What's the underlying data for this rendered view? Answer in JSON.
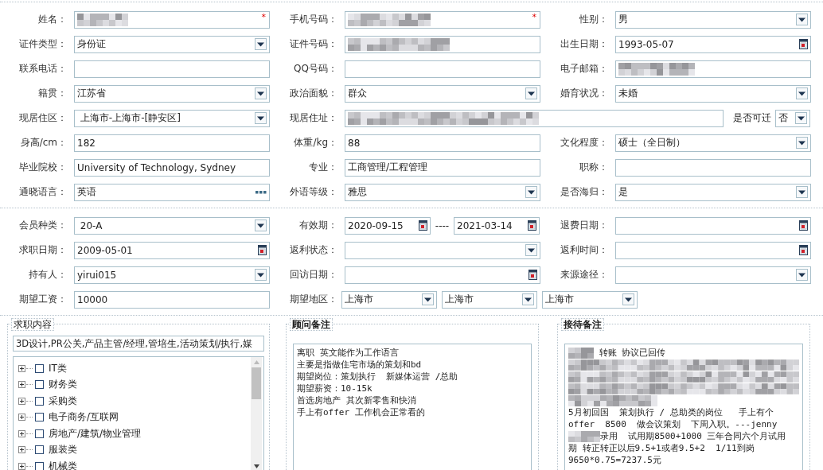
{
  "profile_rows": [
    [
      {
        "label": "姓名：",
        "kind": "blurred",
        "required_mark": "*"
      },
      {
        "label": "手机号码：",
        "kind": "blurred",
        "required_mark": "*"
      },
      {
        "label": "性别：",
        "kind": "select",
        "value": "男"
      }
    ],
    [
      {
        "label": "证件类型：",
        "kind": "select",
        "value": "身份证"
      },
      {
        "label": "证件号码：",
        "kind": "blurred"
      },
      {
        "label": "出生日期：",
        "kind": "date",
        "value": "1993-05-07"
      }
    ],
    [
      {
        "label": "联系电话：",
        "kind": "text"
      },
      {
        "label": "QQ号码：",
        "kind": "text"
      },
      {
        "label": "电子邮箱：",
        "kind": "blurred"
      }
    ],
    [
      {
        "label": "籍贯：",
        "kind": "select",
        "value": "江苏省"
      },
      {
        "label": "政治面貌：",
        "kind": "select",
        "value": "群众"
      },
      {
        "label": "婚育状况：",
        "kind": "select",
        "value": "未婚"
      }
    ],
    [
      {
        "label": "现居住区：",
        "kind": "select",
        "value": " 上海市-上海市-[静安区]"
      },
      {
        "label": "现居住址：",
        "kind": "address",
        "relocate": {
          "label": "是否可迁",
          "value": "否"
        }
      }
    ],
    [
      {
        "label": "身高/cm：",
        "kind": "text",
        "value": "182"
      },
      {
        "label": "体重/kg：",
        "kind": "text",
        "value": "88"
      },
      {
        "label": "文化程度：",
        "kind": "select",
        "value": "硕士（全日制）"
      }
    ],
    [
      {
        "label": "毕业院校：",
        "kind": "text",
        "value": "University of Technology, Sydney"
      },
      {
        "label": "专业：",
        "kind": "text",
        "value": "工商管理/工程管理"
      },
      {
        "label": "职称：",
        "kind": "text"
      }
    ],
    [
      {
        "label": "通晓语言：",
        "kind": "lookup",
        "value": "英语"
      },
      {
        "label": "外语等级：",
        "kind": "select",
        "value": "雅思"
      },
      {
        "label": "是否海归：",
        "kind": "select",
        "value": "是"
      }
    ]
  ],
  "membership_rows": [
    [
      {
        "label": "会员种类：",
        "kind": "select",
        "value": " 20-A"
      },
      {
        "label": "有效期：",
        "kind": "date_range",
        "values": [
          "2020-09-15",
          "2021-03-14"
        ],
        "separator": "----"
      },
      {
        "label": "退费日期：",
        "kind": "date"
      }
    ],
    [
      {
        "label": "求职日期：",
        "kind": "date",
        "value": "2009-05-01"
      },
      {
        "label": "返利状态：",
        "kind": "select"
      },
      {
        "label": "返利时间：",
        "kind": "date"
      }
    ],
    [
      {
        "label": "持有人：",
        "kind": "select",
        "value": "yirui015"
      },
      {
        "label": "回访日期：",
        "kind": "date"
      },
      {
        "label": "来源途径：",
        "kind": "select"
      }
    ],
    [
      {
        "label": "期望工资：",
        "kind": "text",
        "value": "10000"
      },
      {
        "label": "期望地区：",
        "kind": "region",
        "values": [
          "上海市",
          "上海市",
          "上海市"
        ]
      }
    ]
  ],
  "job_panel": {
    "legend": "求职内容",
    "summary": "3D设计,PR公关,产品主管/经理,管培生,活动策划/执行,媒",
    "tree": [
      {
        "label": "IT类",
        "expanded": false,
        "checked": false
      },
      {
        "label": "财务类",
        "expanded": false,
        "checked": false
      },
      {
        "label": "采购类",
        "expanded": false,
        "checked": false
      },
      {
        "label": "电子商务/互联网",
        "expanded": false,
        "checked": false
      },
      {
        "label": "房地产/建筑/物业管理",
        "expanded": false,
        "checked": false
      },
      {
        "label": "服装类",
        "expanded": false,
        "checked": false
      },
      {
        "label": "机械类",
        "expanded": false,
        "checked": false
      }
    ]
  },
  "consultant_notes": {
    "legend": "顾问备注",
    "lines": [
      {
        "kind": "text",
        "text": "离职 英文能作为工作语言"
      },
      {
        "kind": "text",
        "text": "主要是指做住宅市场的策划和bd"
      },
      {
        "kind": "text",
        "text": "期望岗位：策划执行  新媒体运营 /总助"
      },
      {
        "kind": "text",
        "text": "期望薪资：10-15k"
      },
      {
        "kind": "text",
        "text": "首选房地产 其次新零售和快消"
      },
      {
        "kind": "text",
        "text": "手上有offer 工作机会正常看的"
      }
    ]
  },
  "reception_notes": {
    "legend": "接待备注",
    "lines": [
      {
        "kind": "prefixed",
        "text": " 转账 协议已回传"
      },
      {
        "kind": "blurred"
      },
      {
        "kind": "blurred"
      },
      {
        "kind": "blurred"
      },
      {
        "kind": "blurred"
      },
      {
        "kind": "text",
        "text": "5月初回国  策划执行 / 总助类的岗位   手上有个"
      },
      {
        "kind": "text",
        "text": "offer  8500  做会议策划  下周入职。---jenny"
      },
      {
        "kind": "prefixed",
        "text": "录用  试用期8500+1000 三年合同六个月试用"
      },
      {
        "kind": "text",
        "text": "期 转正转正以后9.5+1或者9.5+2  1/11到岗"
      },
      {
        "kind": "text",
        "text": "9650*0.75=7237.5元"
      }
    ]
  }
}
